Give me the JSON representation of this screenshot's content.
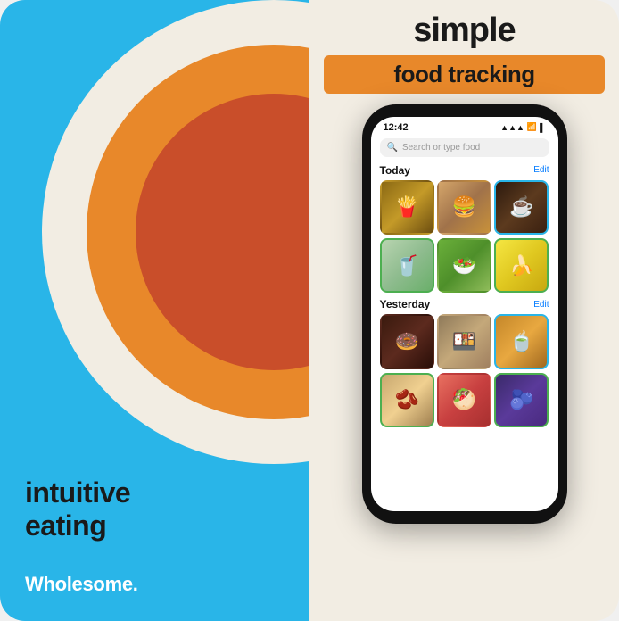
{
  "left": {
    "tagline_line1": "intuitive",
    "tagline_line2": "eating",
    "brand": "Wholesome."
  },
  "right": {
    "title_simple": "simple",
    "title_subtitle": "food tracking",
    "phone": {
      "status_time": "12:42",
      "status_icons": "▲ WiFi Batt",
      "search_placeholder": "Search or type food",
      "sections": [
        {
          "name": "Today",
          "edit_label": "Edit",
          "rows": [
            [
              "fries",
              "burger",
              "coffee"
            ],
            [
              "smoothie",
              "salad",
              "banana"
            ]
          ]
        },
        {
          "name": "Yesterday",
          "edit_label": "Edit",
          "rows": [
            [
              "donut",
              "rice",
              "tea"
            ],
            [
              "chickpeas",
              "bowl",
              "blueberries"
            ]
          ]
        }
      ]
    }
  }
}
